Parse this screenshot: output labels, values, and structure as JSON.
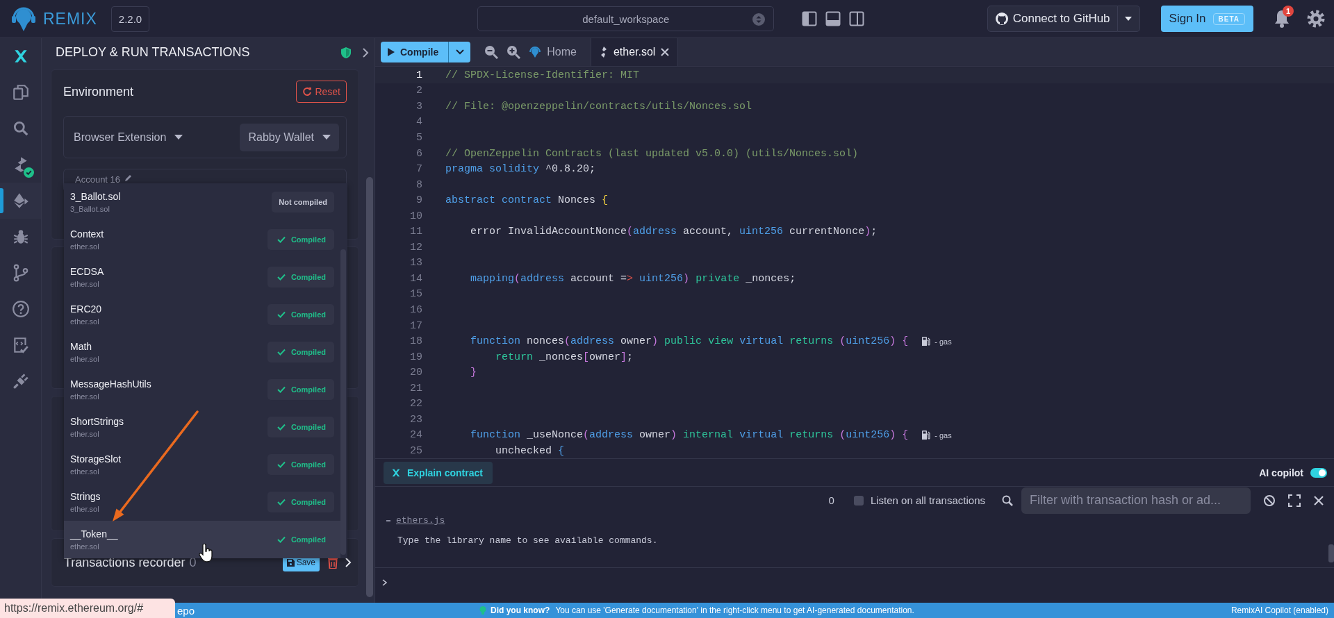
{
  "top_bar": {
    "brand": "REMIX",
    "version": "2.2.0",
    "workspace": "default_workspace",
    "github_button": "Connect to GitHub",
    "sign_in": "Sign In",
    "sign_in_badge": "BETA",
    "notifications": "1"
  },
  "icon_bar": {
    "items": [
      {
        "kind": "ai",
        "selected": false,
        "badge": false
      },
      {
        "kind": "files",
        "selected": false,
        "badge": false
      },
      {
        "kind": "search",
        "selected": false,
        "badge": false
      },
      {
        "kind": "compiler",
        "selected": false,
        "badge": true
      },
      {
        "kind": "deploy",
        "selected": true,
        "badge": false
      },
      {
        "kind": "debugger",
        "selected": false,
        "badge": false
      },
      {
        "kind": "git",
        "selected": false,
        "badge": false
      },
      {
        "kind": "help",
        "selected": false,
        "badge": false
      },
      {
        "kind": "tests",
        "selected": false,
        "badge": false
      },
      {
        "kind": "plugins",
        "selected": false,
        "badge": false
      }
    ]
  },
  "panel": {
    "title": "DEPLOY & RUN TRANSACTIONS",
    "environment": {
      "label": "Environment",
      "reset": "Reset",
      "provider": "Browser Extension",
      "wallet": "Rabby Wallet"
    },
    "account": "Account 16",
    "recorder": {
      "label": "Transactions recorder",
      "count": "0",
      "save": "Save"
    }
  },
  "contract_dropdown": {
    "items": [
      {
        "name": "3_Ballot.sol",
        "file": "3_Ballot.sol",
        "status": "Not compiled",
        "compiled": false,
        "selected": false
      },
      {
        "name": "Context",
        "file": "ether.sol",
        "status": "Compiled",
        "compiled": true,
        "selected": false
      },
      {
        "name": "ECDSA",
        "file": "ether.sol",
        "status": "Compiled",
        "compiled": true,
        "selected": false
      },
      {
        "name": "ERC20",
        "file": "ether.sol",
        "status": "Compiled",
        "compiled": true,
        "selected": false
      },
      {
        "name": "Math",
        "file": "ether.sol",
        "status": "Compiled",
        "compiled": true,
        "selected": false
      },
      {
        "name": "MessageHashUtils",
        "file": "ether.sol",
        "status": "Compiled",
        "compiled": true,
        "selected": false
      },
      {
        "name": "ShortStrings",
        "file": "ether.sol",
        "status": "Compiled",
        "compiled": true,
        "selected": false
      },
      {
        "name": "StorageSlot",
        "file": "ether.sol",
        "status": "Compiled",
        "compiled": true,
        "selected": false
      },
      {
        "name": "Strings",
        "file": "ether.sol",
        "status": "Compiled",
        "compiled": true,
        "selected": false
      },
      {
        "name": "__Token__",
        "file": "ether.sol",
        "status": "Compiled",
        "compiled": true,
        "selected": true
      }
    ]
  },
  "editor": {
    "compile": "Compile",
    "tabs": [
      {
        "label": "Home",
        "kind": "home",
        "selected": false
      },
      {
        "label": "ether.sol",
        "kind": "file",
        "selected": true
      }
    ],
    "lines": [
      {
        "number": "1",
        "active": true,
        "tokens": [
          {
            "kind": "comment",
            "text": "// SPDX-License-Identifier: MIT"
          }
        ]
      },
      {
        "number": "2",
        "active": false
      },
      {
        "number": "3",
        "active": false,
        "tokens": [
          {
            "kind": "comment",
            "text": "// File: @openzeppelin/contracts/utils/Nonces.sol"
          }
        ]
      },
      {
        "number": "4",
        "active": false
      },
      {
        "number": "5",
        "active": false
      },
      {
        "number": "6",
        "active": false,
        "tokens": [
          {
            "kind": "comment",
            "text": "// OpenZeppelin Contracts (last updated v5.0.0) (utils/Nonces.sol)"
          }
        ]
      },
      {
        "number": "7",
        "active": false,
        "tokens": [
          {
            "kind": "type",
            "text": "pragma"
          },
          {
            "kind": "type",
            "text": " solidity"
          },
          {
            "kind": "plain",
            "text": " ^0.8.20;"
          }
        ]
      },
      {
        "number": "8",
        "active": false
      },
      {
        "number": "9",
        "active": false,
        "tokens": [
          {
            "kind": "type",
            "text": "abstract"
          },
          {
            "kind": "type",
            "text": " contract"
          },
          {
            "kind": "plain",
            "text": " Nonces "
          },
          {
            "kind": "brace",
            "text": "{"
          }
        ]
      },
      {
        "number": "10",
        "active": false
      },
      {
        "number": "11",
        "active": false,
        "tokens": [
          {
            "kind": "plain",
            "text": "    error InvalidAccountNonce"
          },
          {
            "kind": "paren",
            "text": "("
          },
          {
            "kind": "type",
            "text": "address"
          },
          {
            "kind": "plain",
            "text": " account, "
          },
          {
            "kind": "type",
            "text": "uint256"
          },
          {
            "kind": "plain",
            "text": " currentNonce"
          },
          {
            "kind": "paren",
            "text": ")"
          },
          {
            "kind": "plain",
            "text": ";"
          }
        ]
      },
      {
        "number": "12",
        "active": false
      },
      {
        "number": "13",
        "active": false
      },
      {
        "number": "14",
        "active": false,
        "tokens": [
          {
            "kind": "type",
            "text": "    mapping"
          },
          {
            "kind": "paren",
            "text": "("
          },
          {
            "kind": "type",
            "text": "address"
          },
          {
            "kind": "plain",
            "text": " account ="
          },
          {
            "kind": "operator",
            "text": ">"
          },
          {
            "kind": "type",
            "text": " uint256"
          },
          {
            "kind": "paren",
            "text": ")"
          },
          {
            "kind": "modifier",
            "text": " private"
          },
          {
            "kind": "plain",
            "text": " _nonces;"
          }
        ]
      },
      {
        "number": "15",
        "active": false
      },
      {
        "number": "16",
        "active": false
      },
      {
        "number": "17",
        "active": false
      },
      {
        "number": "18",
        "active": false,
        "gas": "- gas",
        "tokens": [
          {
            "kind": "type",
            "text": "    function"
          },
          {
            "kind": "plain",
            "text": " nonces"
          },
          {
            "kind": "paren",
            "text": "("
          },
          {
            "kind": "type",
            "text": "address"
          },
          {
            "kind": "plain",
            "text": " owner"
          },
          {
            "kind": "paren",
            "text": ")"
          },
          {
            "kind": "modifier",
            "text": " public"
          },
          {
            "kind": "modifier",
            "text": " view"
          },
          {
            "kind": "type",
            "text": " virtual"
          },
          {
            "kind": "modifier",
            "text": " returns"
          },
          {
            "kind": "paren",
            "text": " ("
          },
          {
            "kind": "type",
            "text": "uint256"
          },
          {
            "kind": "paren",
            "text": ")"
          },
          {
            "kind": "paren",
            "text": " {"
          }
        ]
      },
      {
        "number": "19",
        "active": false,
        "tokens": [
          {
            "kind": "modifier",
            "text": "        return"
          },
          {
            "kind": "plain",
            "text": " _nonces"
          },
          {
            "kind": "paren",
            "text": "["
          },
          {
            "kind": "plain",
            "text": "owner"
          },
          {
            "kind": "paren",
            "text": "]"
          },
          {
            "kind": "plain",
            "text": ";"
          }
        ]
      },
      {
        "number": "20",
        "active": false,
        "tokens": [
          {
            "kind": "paren",
            "text": "    }"
          }
        ]
      },
      {
        "number": "21",
        "active": false
      },
      {
        "number": "22",
        "active": false
      },
      {
        "number": "23",
        "active": false
      },
      {
        "number": "24",
        "active": false,
        "gas": "- gas",
        "tokens": [
          {
            "kind": "type",
            "text": "    function"
          },
          {
            "kind": "plain",
            "text": " _useNonce"
          },
          {
            "kind": "paren",
            "text": "("
          },
          {
            "kind": "type",
            "text": "address"
          },
          {
            "kind": "plain",
            "text": " owner"
          },
          {
            "kind": "paren",
            "text": ")"
          },
          {
            "kind": "modifier",
            "text": " internal"
          },
          {
            "kind": "type",
            "text": " virtual"
          },
          {
            "kind": "modifier",
            "text": " returns"
          },
          {
            "kind": "paren",
            "text": " ("
          },
          {
            "kind": "type",
            "text": "uint256"
          },
          {
            "kind": "paren",
            "text": ")"
          },
          {
            "kind": "paren",
            "text": " {"
          }
        ]
      },
      {
        "number": "25",
        "active": false,
        "tokens": [
          {
            "kind": "plain",
            "text": "        unchecked "
          },
          {
            "kind": "type",
            "text": "{"
          }
        ]
      }
    ]
  },
  "assistant_bar": {
    "explain": "Explain contract",
    "copilot_label": "AI copilot",
    "copilot_on": true
  },
  "terminal": {
    "count": "0",
    "listen_label": "Listen on all transactions",
    "listen_checked": false,
    "filter_placeholder": "Filter with transaction hash or ad...",
    "link": "ethers.js",
    "output": "Type the library name to see available commands."
  },
  "status_bar": {
    "cut_text": "epo",
    "tip_title": "Did you know?",
    "tip": "You can use 'Generate documentation' in the right-click menu to get AI-generated documentation.",
    "copilot": "RemixAI Copilot (enabled)"
  },
  "link_tooltip": "https://remix.ethereum.org/#"
}
